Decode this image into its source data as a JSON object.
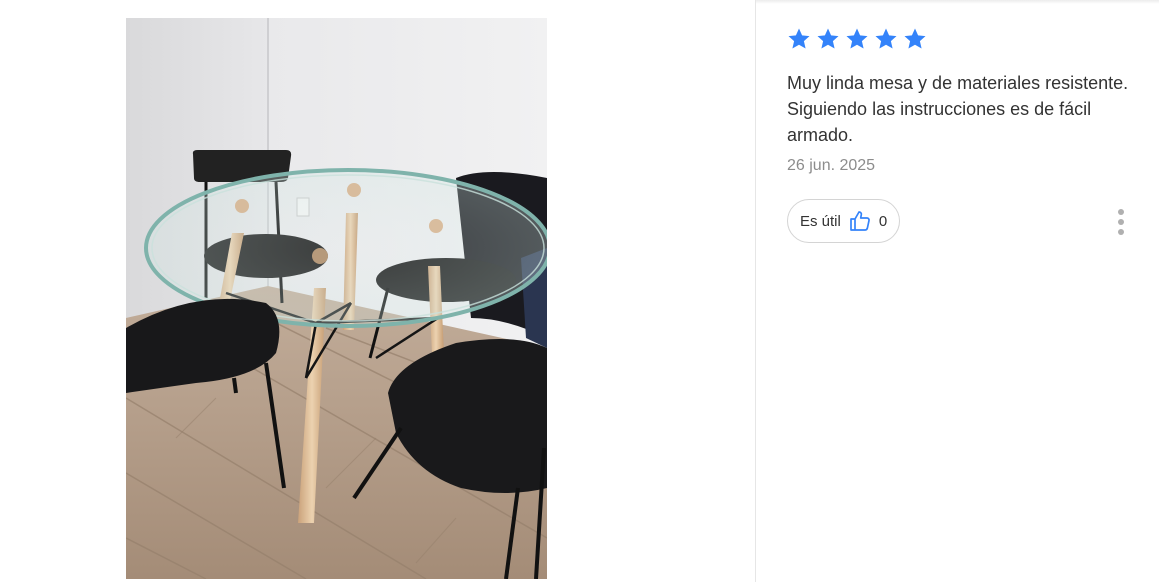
{
  "review": {
    "rating": 5,
    "max_rating": 5,
    "star_color": "#3483fa",
    "text": "Muy linda mesa y de materiales resistente. Siguiendo las instrucciones es de fácil armado.",
    "date": "26 jun. 2025",
    "helpful_label": "Es útil",
    "helpful_count": "0",
    "helpful_icon": "thumbs-up-icon",
    "more_icon": "more-vertical-icon"
  },
  "photo": {
    "subject": "round-glass-table-with-black-chairs"
  }
}
